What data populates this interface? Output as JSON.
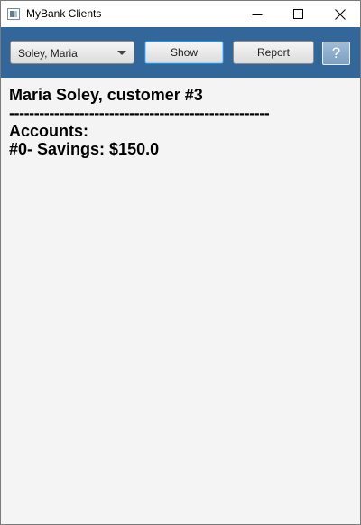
{
  "window": {
    "title": "MyBank Clients",
    "minimize_symbol": "—",
    "maximize_symbol": "□",
    "close_symbol": "✕"
  },
  "toolbar": {
    "customer_select": {
      "selected": "Soley, Maria"
    },
    "show_label": "Show",
    "report_label": "Report",
    "help_label": "?"
  },
  "report": {
    "heading": "Maria Soley, customer #3",
    "separator": "----------------------------------------------------",
    "accounts_label": "Accounts:",
    "accounts": [
      "#0- Savings: $150.0"
    ]
  },
  "colors": {
    "toolbar_background": "#336699",
    "content_background": "#f4f4f4",
    "focused_button_border": "#2a8fd6",
    "help_button": "#8aabcc"
  }
}
